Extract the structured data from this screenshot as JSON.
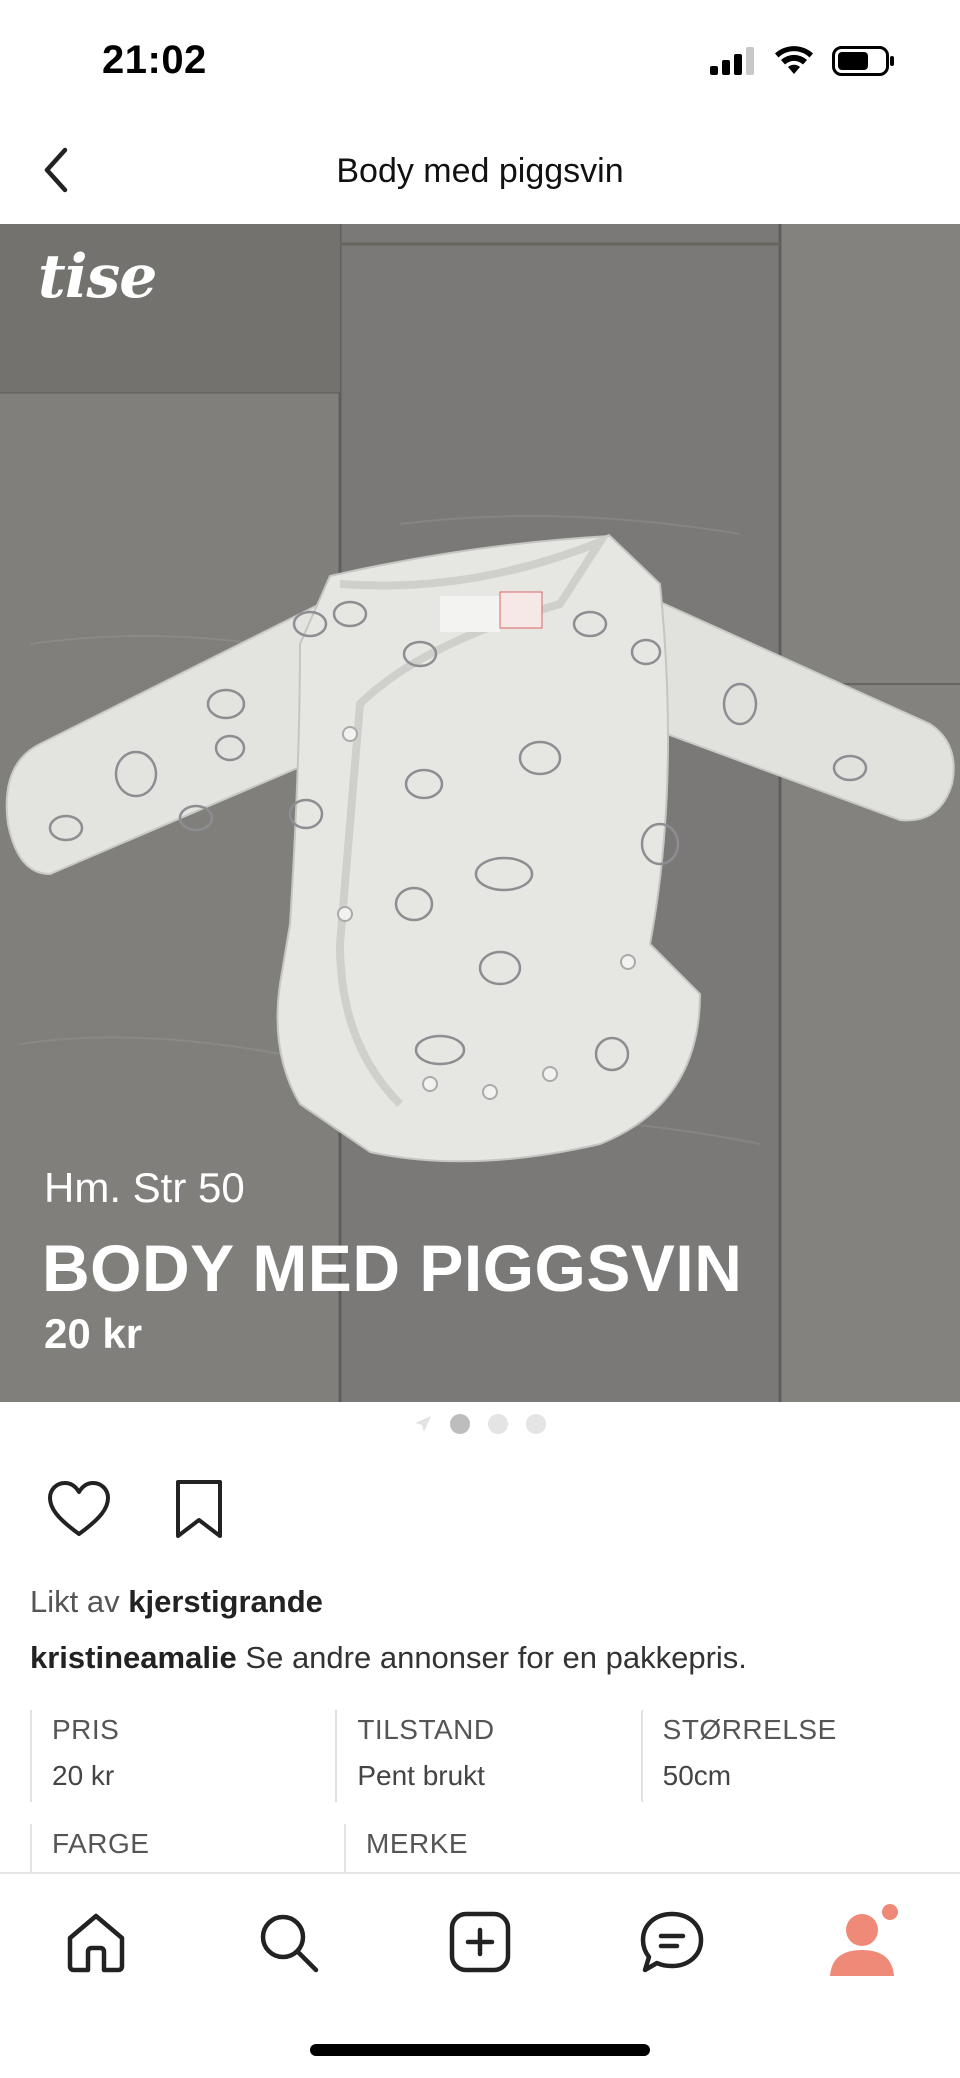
{
  "status_bar": {
    "time": "21:02"
  },
  "header": {
    "title": "Body med piggsvin"
  },
  "hero": {
    "logo": "tise",
    "subtitle": "Hm. Str 50",
    "title": "BODY MED PIGGSVIN",
    "price": "20 kr",
    "image_count": 3,
    "active_image": 1
  },
  "social": {
    "liked_prefix": "Likt av ",
    "liked_user": "kjerstigrande",
    "seller": "kristineamalie",
    "description": " Se andre annonser for en pakkepris."
  },
  "details": {
    "price_label": "PRIS",
    "price_value": "20 kr",
    "condition_label": "TILSTAND",
    "condition_value": "Pent brukt",
    "size_label": "STØRRELSE",
    "size_value": "50cm",
    "color_label": "FARGE",
    "brand_label": "MERKE"
  },
  "tabs": [
    {
      "icon": "home-icon"
    },
    {
      "icon": "search-icon"
    },
    {
      "icon": "add-icon"
    },
    {
      "icon": "chat-icon"
    },
    {
      "icon": "profile-icon"
    }
  ],
  "colors": {
    "accent": "#f08a78",
    "notification": "#f08a78",
    "floor": "#7b7a78"
  }
}
